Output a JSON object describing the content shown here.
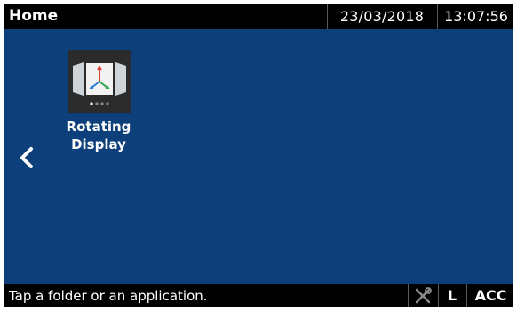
{
  "header": {
    "title": "Home",
    "date": "23/03/2018",
    "time": "13:07:56"
  },
  "apps": [
    {
      "label_line1": "Rotating",
      "label_line2": "Display",
      "icon": "rotating-display-icon"
    }
  ],
  "navigation": {
    "back_icon": "chevron-left-icon"
  },
  "status": {
    "message": "Tap a folder or an application.",
    "tools_icon": "tools-icon",
    "lock_indicator": "L",
    "acc_label": "ACC"
  },
  "colors": {
    "background": "#0d3f7a",
    "bar": "#000000",
    "text": "#ffffff"
  }
}
